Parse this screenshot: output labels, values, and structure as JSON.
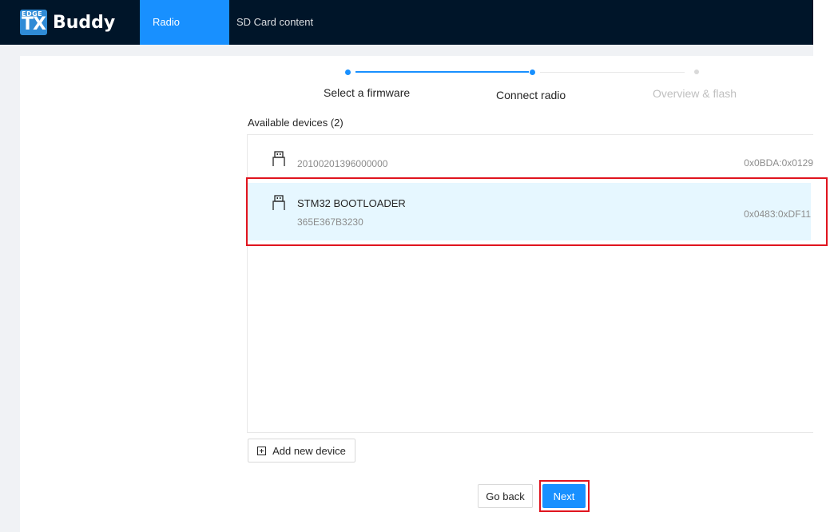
{
  "app": {
    "logo_small": "EDGE",
    "logo_big": "TX",
    "name": "Buddy"
  },
  "nav": {
    "items": [
      {
        "label": "Radio firmware",
        "active": true
      },
      {
        "label": "SD Card content",
        "active": false
      }
    ]
  },
  "steps": [
    {
      "label": "Select a firmware",
      "status": "done"
    },
    {
      "label": "Connect radio",
      "status": "current"
    },
    {
      "label": "Overview & flash",
      "status": "pending"
    }
  ],
  "devices_section": {
    "title": "Available devices (2)"
  },
  "devices": [
    {
      "name": "",
      "serial": "20100201396000000",
      "id": "0x0BDA:0x0129",
      "selected": false,
      "icon": "usb-icon"
    },
    {
      "name": "STM32 BOOTLOADER",
      "serial": "365E367B3230",
      "id": "0x0483:0xDF11",
      "selected": true,
      "icon": "usb-icon"
    }
  ],
  "buttons": {
    "add_device": "Add new device",
    "go_back": "Go back",
    "next": "Next"
  },
  "colors": {
    "header": "#001529",
    "accent": "#1890ff",
    "selected_row": "#e6f7ff",
    "highlight": "#e0141e"
  }
}
